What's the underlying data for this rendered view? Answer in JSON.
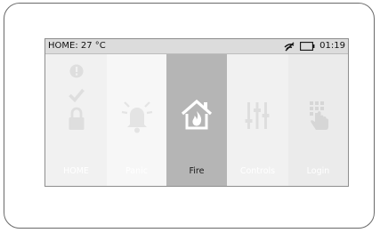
{
  "status_bar": {
    "location_temp": "HOME: 27 °C",
    "clock": "01:19",
    "icons": [
      "signal-off-icon",
      "battery-icon"
    ]
  },
  "tiles": [
    {
      "label": "HOME",
      "icon": "status-icon",
      "selected": false
    },
    {
      "label": "Panic",
      "icon": "alarm-bell-icon",
      "selected": false
    },
    {
      "label": "Fire",
      "icon": "fire-house-icon",
      "selected": true
    },
    {
      "label": "Controls",
      "icon": "sliders-icon",
      "selected": false
    },
    {
      "label": "Login",
      "icon": "keypad-touch-icon",
      "selected": false
    }
  ],
  "colors": {
    "selected_tile": "#b5b5b5",
    "status_bar": "#dcdcdc",
    "unselected_label": "#ffffff",
    "selected_label": "#1a1a1a"
  }
}
